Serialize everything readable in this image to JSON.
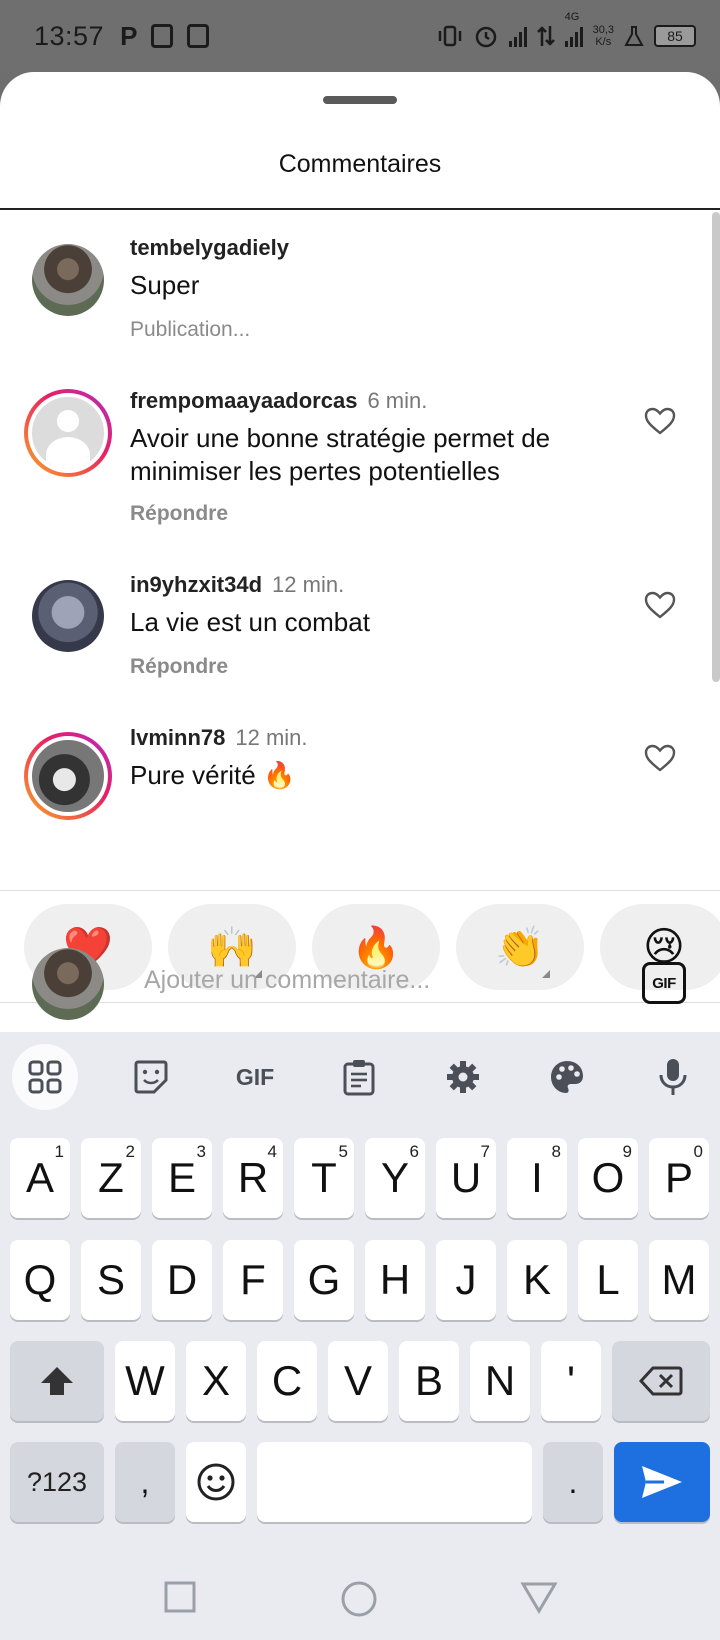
{
  "status_bar": {
    "time": "13:57",
    "network": "4G",
    "speed_value": "30,3",
    "speed_unit": "K/s",
    "battery": "85"
  },
  "sheet": {
    "title": "Commentaires"
  },
  "comments": [
    {
      "username": "tembelygadiely",
      "time": "",
      "text": "Super",
      "meta": "Publication..."
    },
    {
      "username": "frempomaayaadorcas",
      "time": "6 min.",
      "text": "Avoir une bonne stratégie permet de minimiser les pertes potentielles",
      "meta": "Répondre"
    },
    {
      "username": "in9yhzxit34d",
      "time": "12 min.",
      "text": "La vie est un combat",
      "meta": "Répondre"
    },
    {
      "username": "lvminn78",
      "time": "12 min.",
      "text": "Pure vérité 🔥",
      "meta": ""
    }
  ],
  "reactions": [
    "❤️",
    "🙌",
    "🔥",
    "👏",
    "😢"
  ],
  "compose": {
    "placeholder": "Ajouter un commentaire...",
    "gif_label": "GIF"
  },
  "keyboard": {
    "toolbar_gif": "GIF",
    "row1": [
      {
        "k": "A",
        "n": "1"
      },
      {
        "k": "Z",
        "n": "2"
      },
      {
        "k": "E",
        "n": "3"
      },
      {
        "k": "R",
        "n": "4"
      },
      {
        "k": "T",
        "n": "5"
      },
      {
        "k": "Y",
        "n": "6"
      },
      {
        "k": "U",
        "n": "7"
      },
      {
        "k": "I",
        "n": "8"
      },
      {
        "k": "O",
        "n": "9"
      },
      {
        "k": "P",
        "n": "0"
      }
    ],
    "row2": [
      "Q",
      "S",
      "D",
      "F",
      "G",
      "H",
      "J",
      "K",
      "L",
      "M"
    ],
    "row3": [
      "W",
      "X",
      "C",
      "V",
      "B",
      "N",
      "'"
    ],
    "sym_label": "?123",
    "comma": ",",
    "period": "."
  }
}
